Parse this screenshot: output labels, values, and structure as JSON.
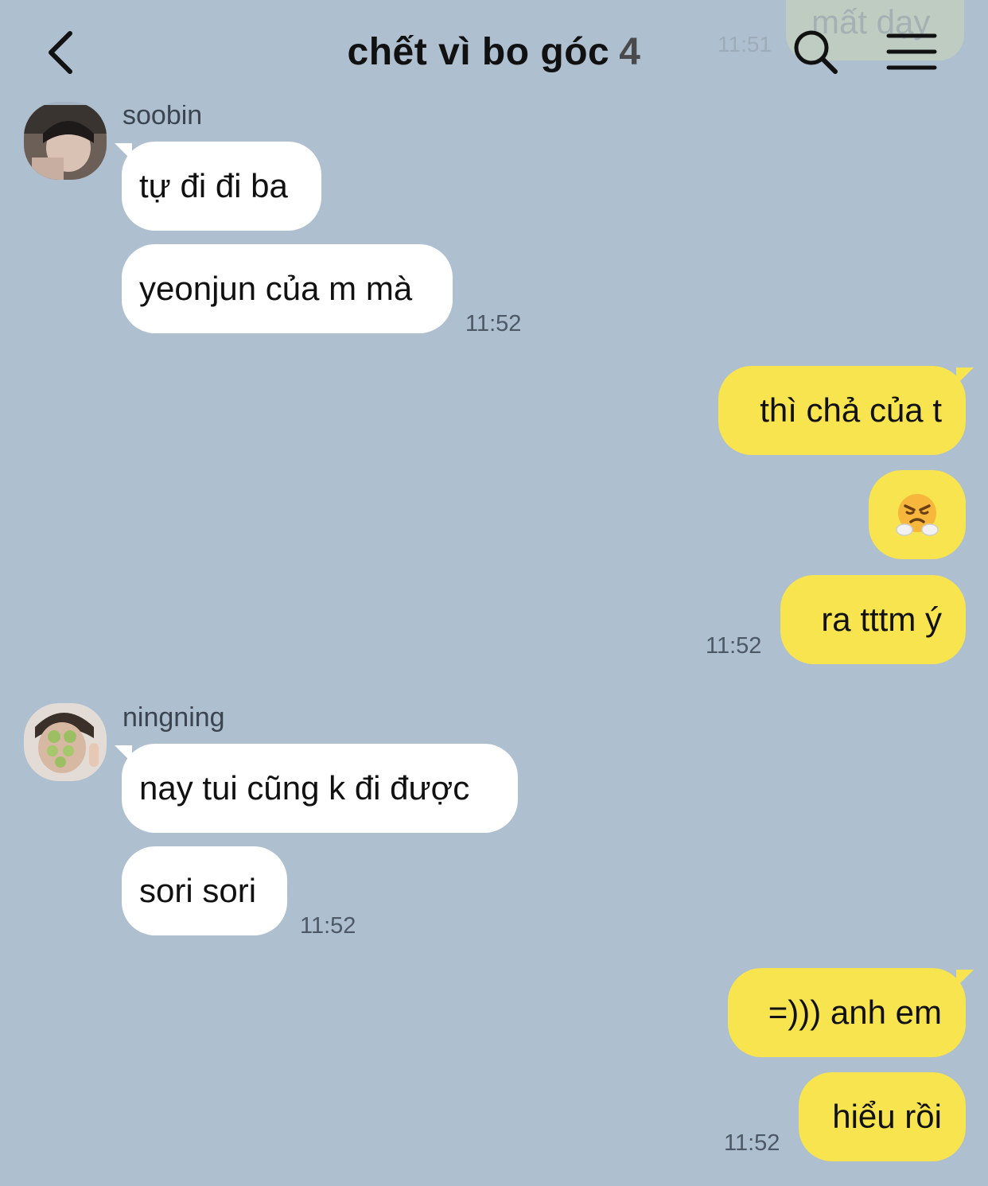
{
  "header": {
    "title": "chết vì bo góc",
    "member_count": "4",
    "back_icon": "chevron-left-icon",
    "search_icon": "search-icon",
    "menu_icon": "hamburger-menu-icon",
    "peek_message": "mất dạy",
    "peek_time": "11:51"
  },
  "colors": {
    "background": "#aebfcf",
    "incoming_bubble": "#ffffff",
    "outgoing_bubble": "#f7e44e"
  },
  "chat": {
    "groups": [
      {
        "sender": "soobin",
        "direction": "incoming",
        "messages": [
          "tự đi đi ba",
          "yeonjun của m mà"
        ],
        "time": "11:52"
      },
      {
        "direction": "outgoing",
        "messages": [
          "thì chả của t",
          "😤",
          "ra tttm ý"
        ],
        "emoji_icon": "huffing-face-emoji",
        "time": "11:52"
      },
      {
        "sender": "ningning",
        "direction": "incoming",
        "messages": [
          "nay tui cũng k đi được",
          "sori sori"
        ],
        "time": "11:52"
      },
      {
        "direction": "outgoing",
        "messages": [
          "=))) anh em",
          "hiểu rồi"
        ],
        "time": "11:52"
      }
    ]
  }
}
